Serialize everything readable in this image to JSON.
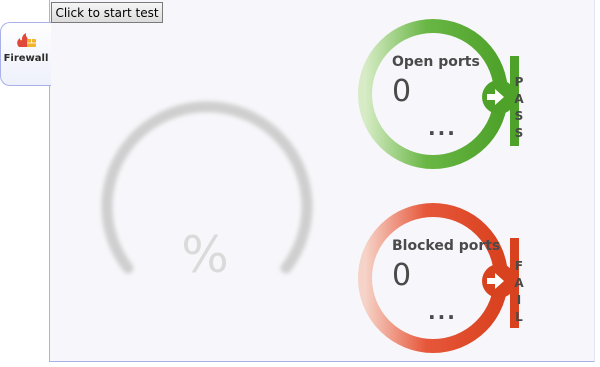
{
  "sidebar": {
    "tab_label": "Firewall"
  },
  "toolbar": {
    "start_label": "Click to start test"
  },
  "gauge": {
    "percent_symbol": "%"
  },
  "open_ports": {
    "title": "Open ports",
    "count": "0",
    "more": "...",
    "status_letters": [
      "P",
      "A",
      "S",
      "S"
    ],
    "color": "#5aa832"
  },
  "blocked_ports": {
    "title": "Blocked ports",
    "count": "0",
    "more": "...",
    "status_letters": [
      "F",
      "A",
      "I",
      "L"
    ],
    "color": "#dd4a2c"
  }
}
